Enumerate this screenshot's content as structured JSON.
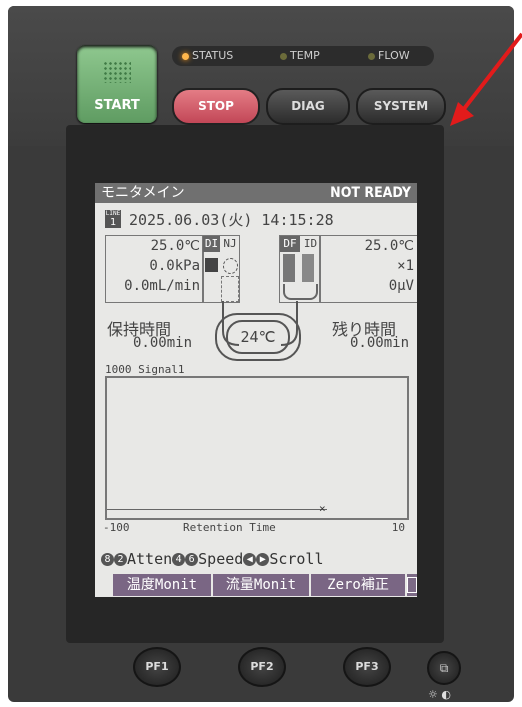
{
  "controls": {
    "start_label": "START",
    "stop_label": "STOP",
    "diag_label": "DIAG",
    "system_label": "SYSTEM",
    "indicators": {
      "status": "STATUS",
      "temp": "TEMP",
      "flow": "FLOW"
    },
    "pf1": "PF1",
    "pf2": "PF2",
    "pf3": "PF3"
  },
  "screen": {
    "title_left": "モニタメイン",
    "title_right": "NOT READY",
    "line_label": "LINE",
    "line_number": "1",
    "datetime": "2025.06.03(火) 14:15:28",
    "left_values": {
      "temp": "25.0℃",
      "pressure": "0.0kPa",
      "flow": "0.0mL/min"
    },
    "inj_header_di": "DI",
    "inj_header_nj": "NJ",
    "det_header_df": "DF",
    "det_header_id": "ID",
    "right_values": {
      "temp": "25.0℃",
      "atten": "×1",
      "signal": "0μV"
    },
    "oven_temp": "24℃",
    "hold_label": "保持時間",
    "hold_value": "0.00min",
    "remain_label": "残り時間",
    "remain_value": "0.00min",
    "graph_top": "1000 Signal1",
    "graph_bottom_left": "-100",
    "graph_bottom_center": "Retention Time",
    "graph_bottom_right": "10",
    "help": {
      "k8": "8",
      "k2": "2",
      "atten": "Atten",
      "k4": "4",
      "k6": "6",
      "speed": "Speed",
      "scroll": "Scroll"
    },
    "softkeys": [
      "温度Monit",
      "流量Monit",
      "Zero補正"
    ]
  },
  "colors": {
    "start": "#6fae70",
    "stop": "#d35a68",
    "status_led": "#ffb64c",
    "softkey": "#7a6684",
    "arrow": "#e21b1b"
  }
}
